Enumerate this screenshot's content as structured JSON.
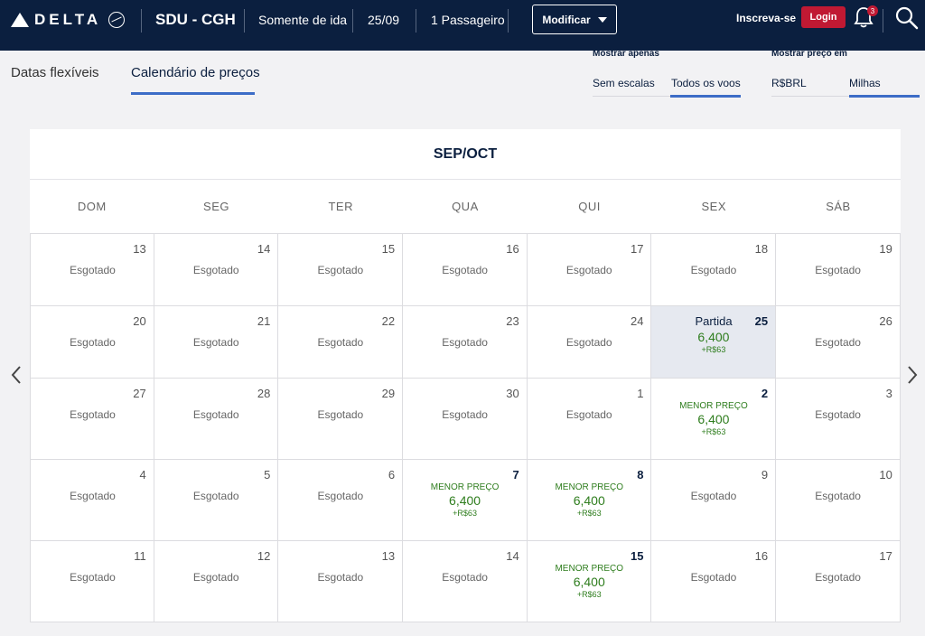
{
  "header": {
    "brand": "DELTA",
    "route": "SDU - CGH",
    "trip_type": "Somente de ida",
    "date": "25/09",
    "passengers": "1 Passageiro",
    "modify_label": "Modificar",
    "signup_label": "Inscreva-se",
    "login_label": "Login",
    "notification_count": "3",
    "colors": {
      "navy": "#0b1f3f",
      "red": "#c01933",
      "accent_blue": "#3d6dc7",
      "price_green": "#2e7d1d"
    }
  },
  "tabs": [
    {
      "label": "Datas flexíveis"
    },
    {
      "label": "Calendário de preços",
      "active": true
    }
  ],
  "filters": {
    "show_only": {
      "label": "Mostrar apenas",
      "options": [
        "Sem escalas",
        "Todos os voos"
      ],
      "selected": "Todos os voos"
    },
    "price_in": {
      "label": "Mostrar preço em",
      "options": [
        "R$BRL",
        "Milhas"
      ],
      "selected": "Milhas"
    }
  },
  "calendar": {
    "title": "SEP/OCT",
    "weekdays": [
      "DOM",
      "SEG",
      "TER",
      "QUA",
      "QUI",
      "SEX",
      "SÁB"
    ],
    "sold_out_label": "Esgotado",
    "lowest_label": "MENOR PREÇO",
    "departure_label": "Partida",
    "weeks": [
      [
        {
          "day": "13",
          "status": "sold_out"
        },
        {
          "day": "14",
          "status": "sold_out"
        },
        {
          "day": "15",
          "status": "sold_out"
        },
        {
          "day": "16",
          "status": "sold_out"
        },
        {
          "day": "17",
          "status": "sold_out"
        },
        {
          "day": "18",
          "status": "sold_out"
        },
        {
          "day": "19",
          "status": "sold_out"
        }
      ],
      [
        {
          "day": "20",
          "status": "sold_out"
        },
        {
          "day": "21",
          "status": "sold_out"
        },
        {
          "day": "22",
          "status": "sold_out"
        },
        {
          "day": "23",
          "status": "sold_out"
        },
        {
          "day": "24",
          "status": "sold_out"
        },
        {
          "day": "25",
          "status": "selected",
          "price": "6,400",
          "surcharge": "+R$63"
        },
        {
          "day": "26",
          "status": "sold_out"
        }
      ],
      [
        {
          "day": "27",
          "status": "sold_out"
        },
        {
          "day": "28",
          "status": "sold_out"
        },
        {
          "day": "29",
          "status": "sold_out"
        },
        {
          "day": "30",
          "status": "sold_out"
        },
        {
          "day": "1",
          "status": "sold_out"
        },
        {
          "day": "2",
          "status": "lowest",
          "price": "6,400",
          "surcharge": "+R$63"
        },
        {
          "day": "3",
          "status": "sold_out"
        }
      ],
      [
        {
          "day": "4",
          "status": "sold_out"
        },
        {
          "day": "5",
          "status": "sold_out"
        },
        {
          "day": "6",
          "status": "sold_out"
        },
        {
          "day": "7",
          "status": "lowest",
          "price": "6,400",
          "surcharge": "+R$63"
        },
        {
          "day": "8",
          "status": "lowest",
          "price": "6,400",
          "surcharge": "+R$63"
        },
        {
          "day": "9",
          "status": "sold_out"
        },
        {
          "day": "10",
          "status": "sold_out"
        }
      ],
      [
        {
          "day": "11",
          "status": "sold_out"
        },
        {
          "day": "12",
          "status": "sold_out"
        },
        {
          "day": "13",
          "status": "sold_out"
        },
        {
          "day": "14",
          "status": "sold_out"
        },
        {
          "day": "15",
          "status": "lowest",
          "price": "6,400",
          "surcharge": "+R$63"
        },
        {
          "day": "16",
          "status": "sold_out"
        },
        {
          "day": "17",
          "status": "sold_out"
        }
      ]
    ]
  },
  "icons": {
    "prev": "chevron-left-icon",
    "next": "chevron-right-icon",
    "notifications": "bell-icon",
    "search": "search-icon"
  }
}
